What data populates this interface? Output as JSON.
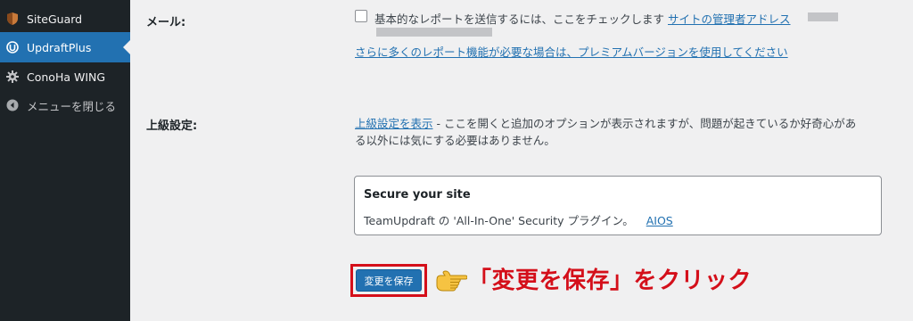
{
  "sidebar": {
    "items": [
      {
        "label": "SiteGuard",
        "icon": "siteguard-shield-icon"
      },
      {
        "label": "UpdraftPlus",
        "icon": "updraftplus-icon",
        "active": true
      },
      {
        "label": "ConoHa WING",
        "icon": "gear-icon"
      },
      {
        "label": "メニューを閉じる",
        "icon": "collapse-menu-icon"
      }
    ],
    "colors": {
      "background": "#1d2327",
      "active": "#2271b1"
    }
  },
  "email": {
    "label": "メール:",
    "checkbox_checked": false,
    "checkbox_text": "基本的なレポートを送信するには、ここをチェックします",
    "admin_link": "サイトの管理者アドレス",
    "premium_link": "さらに多くのレポート機能が必要な場合は、プレミアムバージョンを使用してください"
  },
  "advanced": {
    "label": "上級設定:",
    "link": "上級設定を表示",
    "text_rest": " - ここを開くと追加のオプションが表示されますが、問題が起きているか好奇心があ",
    "text_line2": "る以外には気にする必要はありません。"
  },
  "secure_box": {
    "title": "Secure your site",
    "text": "TeamUpdraft の 'All-In-One' Security プラグイン。",
    "link": "AIOS"
  },
  "save": {
    "button_label": "変更を保存"
  },
  "annotation": {
    "text": "「変更を保存」をクリック",
    "icon": "pointing-hand-icon",
    "color": "#d40f1a"
  }
}
